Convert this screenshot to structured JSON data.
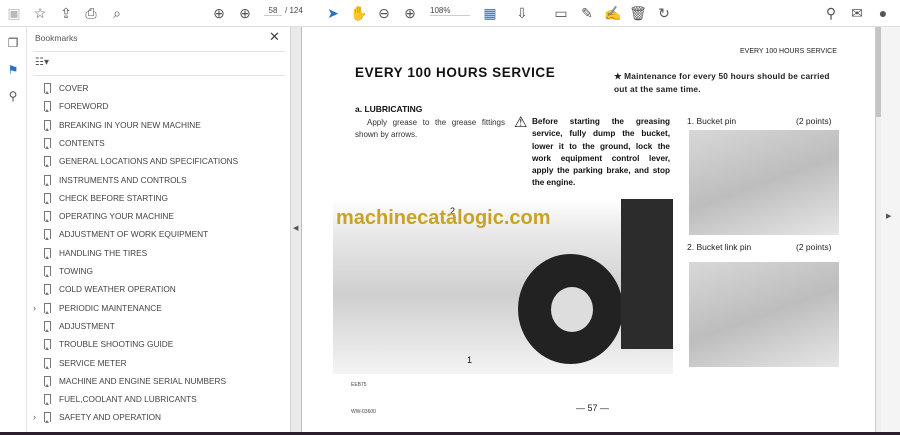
{
  "toolbar": {
    "page_current": "58",
    "page_total": "/ 124",
    "zoom": "108%"
  },
  "bookmarks": {
    "title": "Bookmarks",
    "items": [
      {
        "label": "COVER"
      },
      {
        "label": "FOREWORD"
      },
      {
        "label": "BREAKING IN YOUR NEW MACHINE"
      },
      {
        "label": "CONTENTS"
      },
      {
        "label": "GENERAL LOCATIONS AND SPECIFICATIONS"
      },
      {
        "label": "INSTRUMENTS AND CONTROLS"
      },
      {
        "label": "CHECK BEFORE STARTING"
      },
      {
        "label": "OPERATING YOUR MACHINE"
      },
      {
        "label": "ADJUSTMENT OF WORK EQUIPMENT"
      },
      {
        "label": "HANDLING THE TIRES"
      },
      {
        "label": "TOWING"
      },
      {
        "label": "COLD WEATHER OPERATION"
      },
      {
        "label": "PERIODIC MAINTENANCE",
        "expandable": true
      },
      {
        "label": "ADJUSTMENT"
      },
      {
        "label": "TROUBLE SHOOTING GUIDE"
      },
      {
        "label": "SERVICE METER"
      },
      {
        "label": "MACHINE AND ENGINE SERIAL NUMBERS"
      },
      {
        "label": "FUEL,COOLANT AND LUBRICANTS"
      },
      {
        "label": "SAFETY AND OPERATION",
        "expandable": true
      }
    ]
  },
  "doc": {
    "running_header": "EVERY 100 HOURS SERVICE",
    "title": "EVERY 100 HOURS SERVICE",
    "note": "★ Maintenance for every 50 hours should be carried out at the same time.",
    "section": "a. LUBRICATING",
    "intro": "Apply grease to the grease fittings shown by arrows.",
    "warning": "Before starting the greasing service, fully dump the bucket, lower it to the ground, lock the work equipment control lever, apply the parking brake, and stop the engine.",
    "item1_label": "1. Bucket pin",
    "item1_points": "(2 points)",
    "item2_label": "2. Bucket link pin",
    "item2_points": "(2 points)",
    "callout_1": "1",
    "callout_2": "2",
    "fig_code": "EEB75",
    "watermark": "machinecatalogic.com",
    "footer_code": "WW-03600",
    "page_number": "— 57 —"
  },
  "colors": {
    "watermark": "#c9a227",
    "accent": "#2d6fc4"
  }
}
